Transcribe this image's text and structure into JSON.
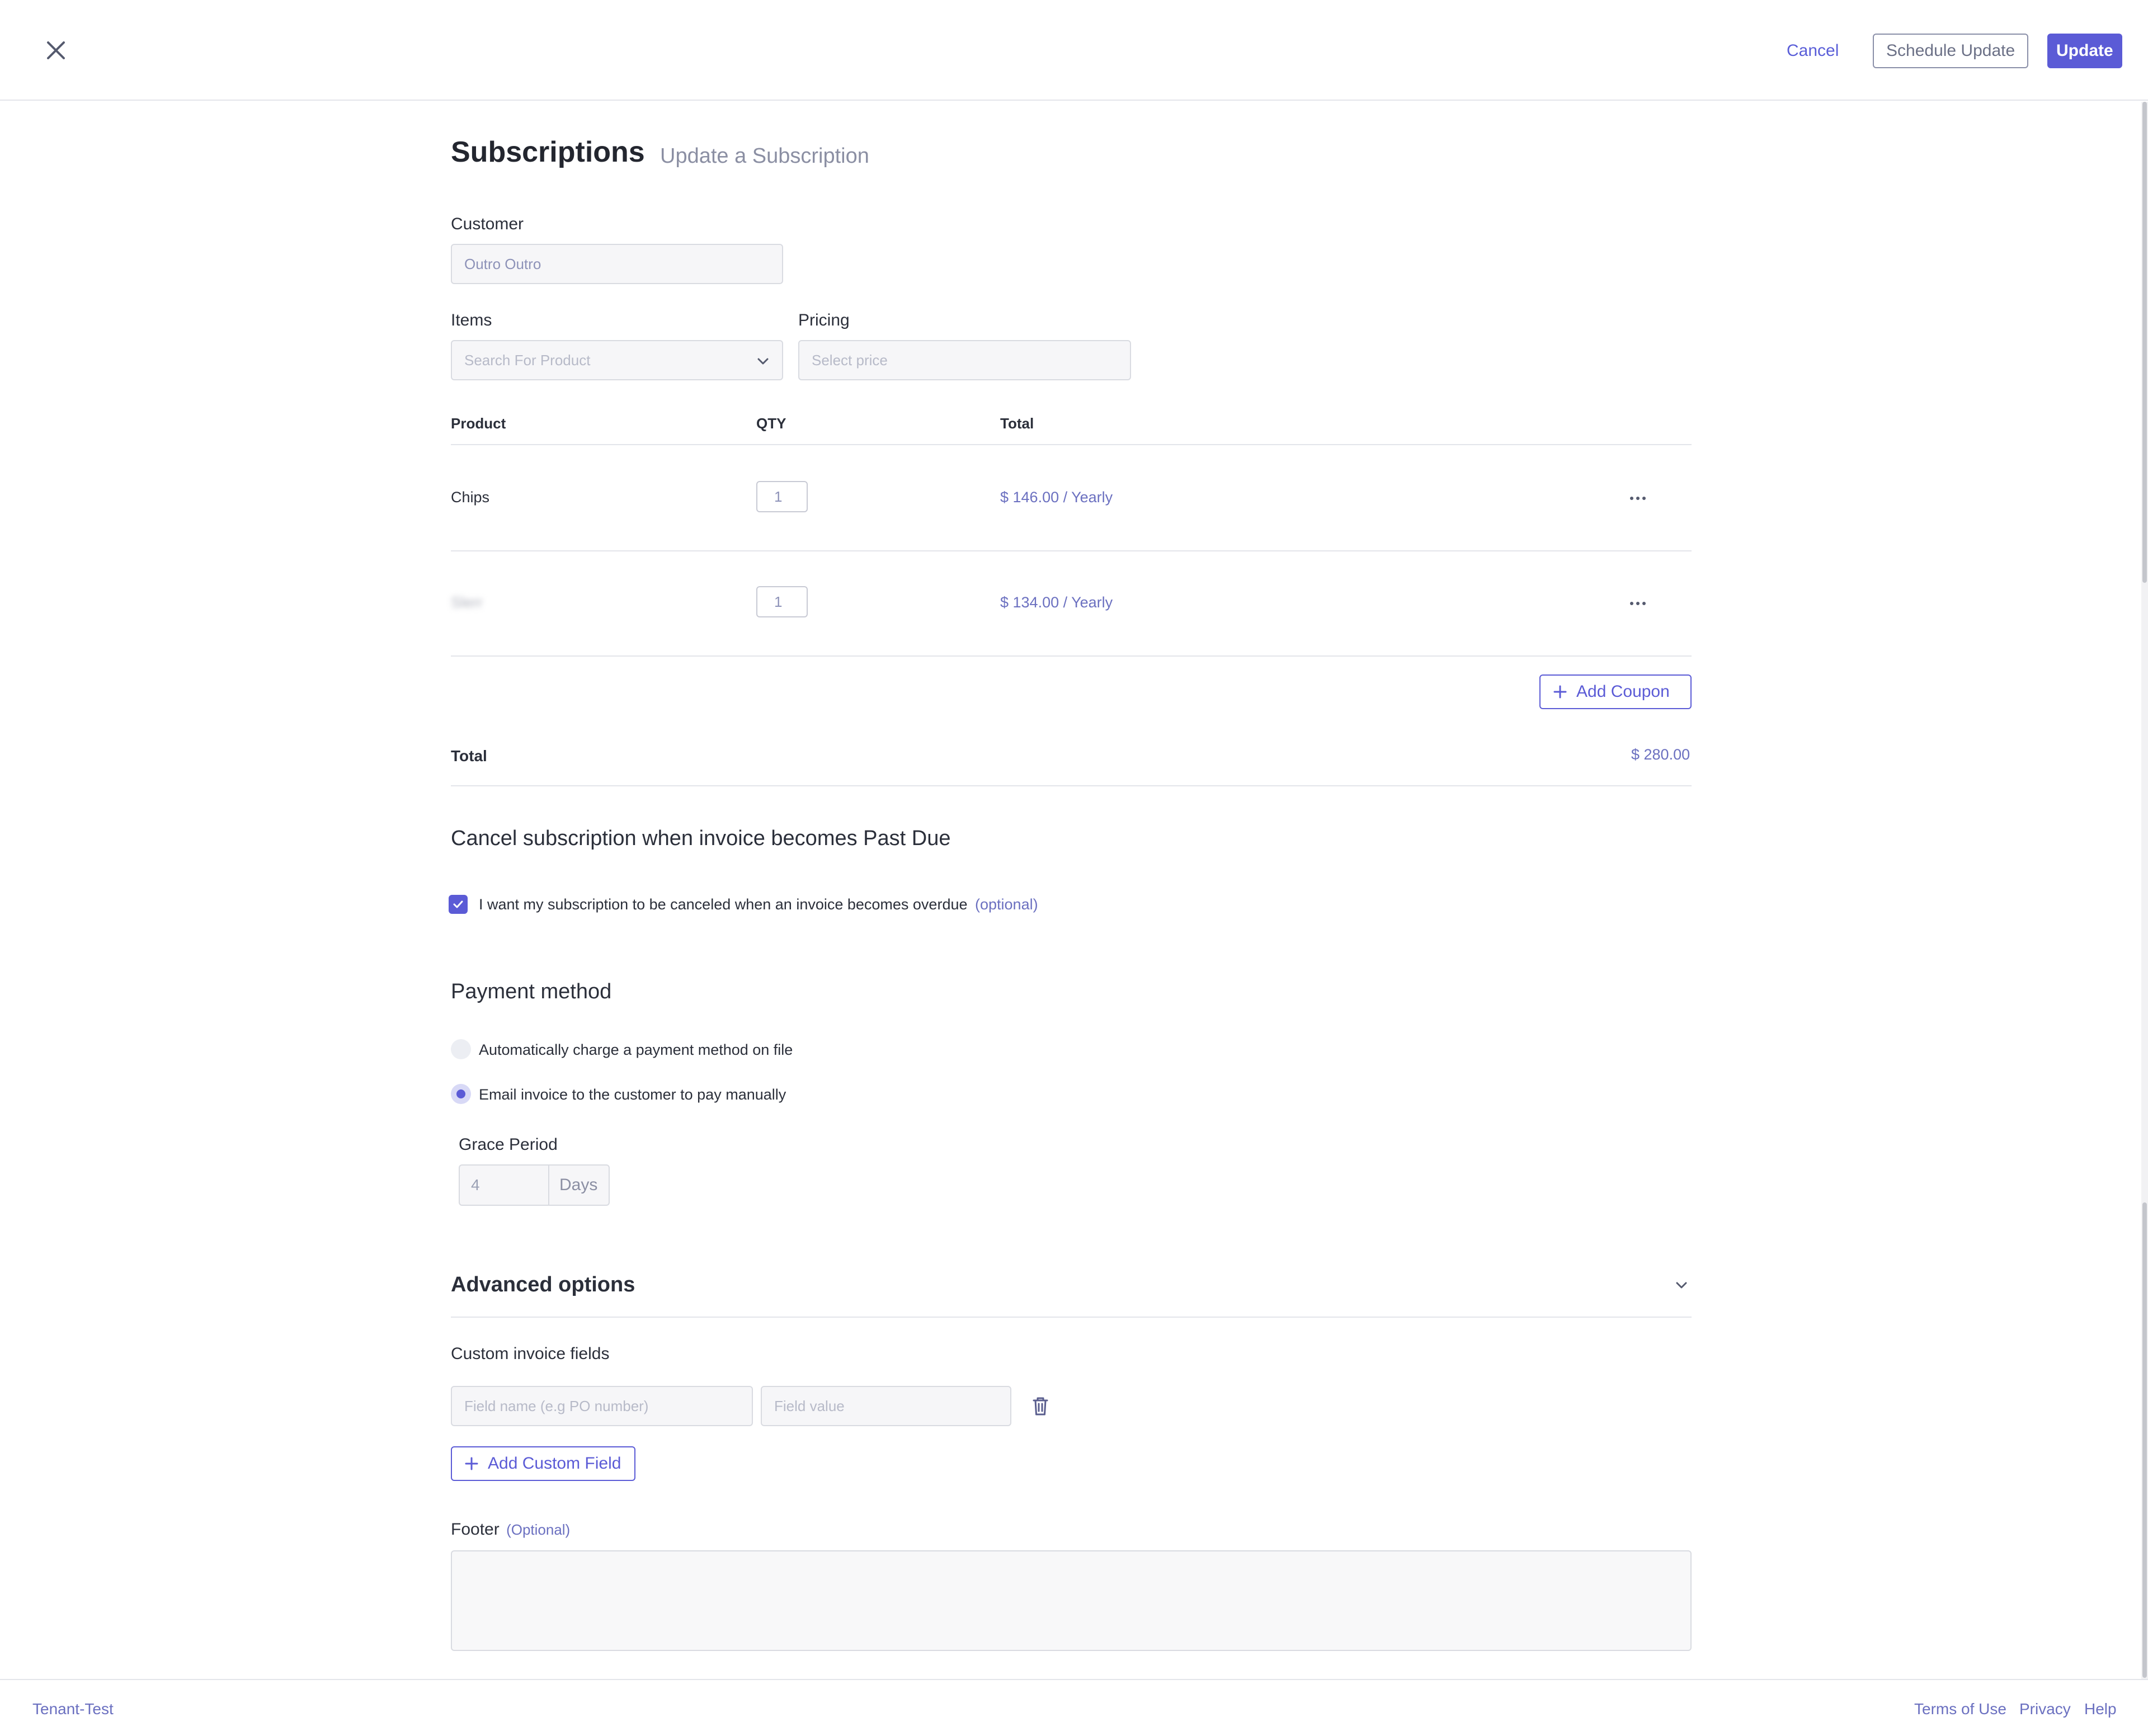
{
  "header": {
    "cancel_label": "Cancel",
    "schedule_label": "Schedule Update",
    "update_label": "Update"
  },
  "page": {
    "title": "Subscriptions",
    "subtitle": "Update a Subscription"
  },
  "customer": {
    "label": "Customer",
    "value": "Outro Outro"
  },
  "items": {
    "label": "Items",
    "placeholder": "Search For Product"
  },
  "pricing": {
    "label": "Pricing",
    "placeholder": "Select price"
  },
  "table": {
    "headers": [
      "Product",
      "QTY",
      "Total"
    ],
    "rows": [
      {
        "product": "Chips",
        "qty": "1",
        "total": "$ 146.00 / Yearly"
      },
      {
        "product": "Slerr",
        "qty": "1",
        "total": "$ 134.00 / Yearly"
      }
    ]
  },
  "coupon": {
    "label": "Add Coupon"
  },
  "totals": {
    "label": "Total",
    "value": "$ 280.00"
  },
  "cancel_section": {
    "title": "Cancel subscription when invoice becomes Past Due",
    "checkbox_label": "I want my subscription to be canceled when an invoice becomes overdue",
    "optional": "(optional)"
  },
  "payment": {
    "title": "Payment method",
    "options": [
      "Automatically charge a payment method on file",
      "Email invoice to the customer to pay manually"
    ],
    "selected": 1
  },
  "grace": {
    "label": "Grace Period",
    "value": "4",
    "unit": "Days"
  },
  "advanced": {
    "title": "Advanced options",
    "custom_fields_label": "Custom invoice fields",
    "field_name_placeholder": "Field name (e.g PO number)",
    "field_value_placeholder": "Field value",
    "add_field_label": "Add Custom Field",
    "footer_label": "Footer",
    "footer_optional": "(Optional)"
  },
  "footer": {
    "tenant": "Tenant-Test",
    "links": [
      "Terms of Use",
      "Privacy",
      "Help"
    ]
  },
  "colors": {
    "accent": "#5b5bd6",
    "link": "#6b70c0",
    "border": "#e3e5ea"
  }
}
